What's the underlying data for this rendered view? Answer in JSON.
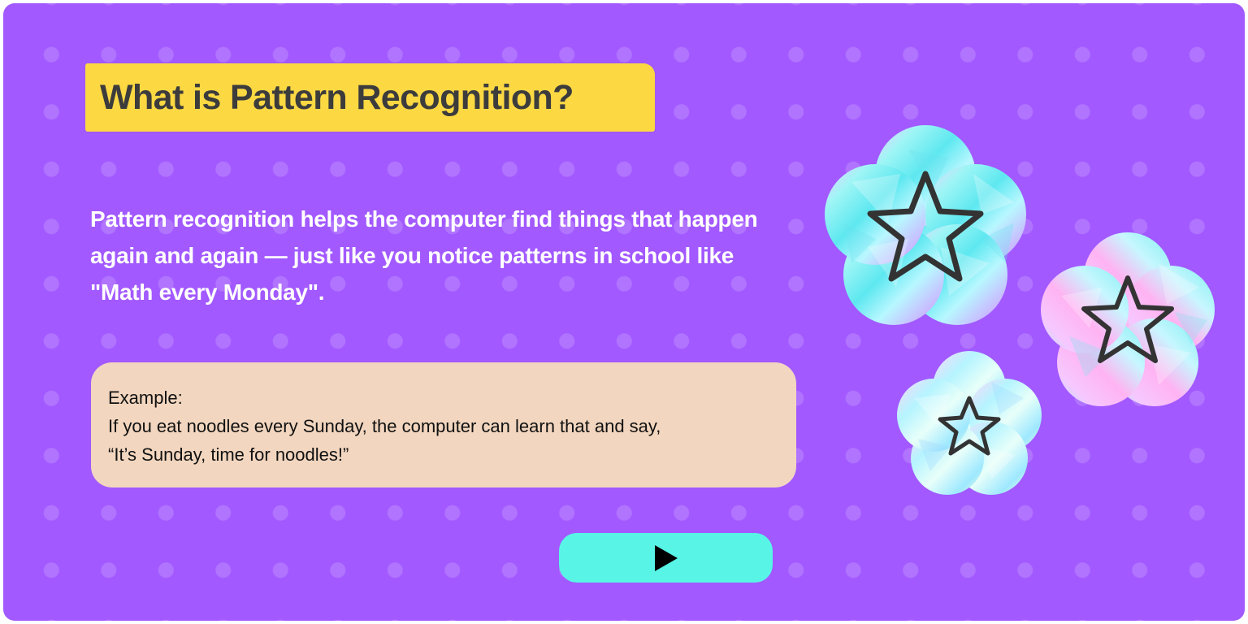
{
  "lesson": {
    "title": "What is Pattern Recognition?",
    "description": "Pattern recognition helps the computer find things that happen again and again — just like you notice patterns in school like \"Math every Monday\".",
    "example": {
      "label": "Example:",
      "line1": "If you eat noodles every Sunday, the computer can learn that and say,",
      "line2": "“It’s Sunday, time for noodles!”"
    }
  },
  "controls": {
    "play_icon": "play-icon"
  },
  "decorations": {
    "badge_icon": "star-icon",
    "badge_count": 3
  },
  "colors": {
    "background": "#a259ff",
    "title_highlight": "#fcd843",
    "title_text": "#3c3c3c",
    "example_background": "#f2d6bf",
    "play_button": "#58f5e6",
    "star_outline": "#333333"
  }
}
